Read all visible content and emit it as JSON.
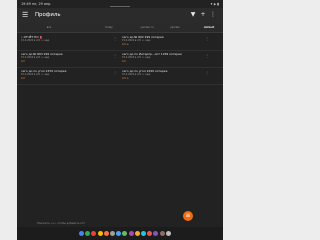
{
  "status": {
    "time": "19:49",
    "date": "пн, 29 апр.",
    "right": "▾ ◈ ▮"
  },
  "appbar": {
    "title": "Профиль",
    "menu_icon": "menu-icon",
    "filter_icon": "filter-icon",
    "add_label": "+",
    "more_icon": "more-vert-icon"
  },
  "columns": [
    {
      "label": "все"
    },
    {
      "label": "today"
    },
    {
      "label": "yandex.ru"
    },
    {
      "label": "yandex"
    },
    {
      "label": "default",
      "active": true
    }
  ],
  "rows": [
    {
      "left": {
        "name": "• ОТЧЁТ ПО",
        "tag": "!",
        "sub": "15.4.2024 в 2/4 •• нед.",
        "score": ""
      },
      "right": {
        "name": "сего до № 802 299 лотерея",
        "sub": "15.4.2024 в 2/4 •• нед.",
        "score": "4.0 ≥"
      }
    },
    {
      "left": {
        "name": "сего до № 803 299 лотерея",
        "sub": "15.4.2024 в 2/4 •• нед.",
        "score": "4.0"
      },
      "right": {
        "name": "сего до по Интерпр...лот 1039 лотерея",
        "sub": "15.4.2024 в 2/4 •• нед.",
        "score": "4.0"
      }
    },
    {
      "left": {
        "name": "сего до по угол 2339 лотерея",
        "sub": "15.4.2024 в 2/4 •• нед.",
        "score": "4.0"
      },
      "right": {
        "name": "сего до по угол 2299 лотерея",
        "sub": "15.4.2024 в 2/4 •• нед.",
        "score": "4.0 ≥"
      }
    }
  ],
  "footer_hint": "Нажмите «+», чтобы добавить лот",
  "fab_label": "≡",
  "navbar_apps": [
    "#4285f4",
    "#34a853",
    "#ea4335",
    "#fbbc05",
    "#ff7043",
    "#9e9e9e",
    "#42a5f5",
    "#66bb6a",
    "#ab47bc",
    "#ffa726",
    "#26c6da",
    "#ef5350",
    "#7e57c2",
    "#8d6e63",
    "#bdbdbd"
  ]
}
